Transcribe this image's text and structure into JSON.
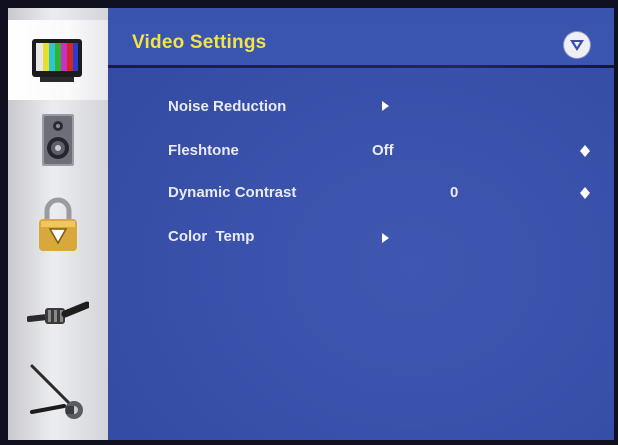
{
  "header": {
    "title": "Video Settings",
    "logo_icon": "vizio-v-logo-icon"
  },
  "sidebar": {
    "items": [
      {
        "icon": "tv-color-bars-icon",
        "active": true
      },
      {
        "icon": "speaker-icon",
        "active": false
      },
      {
        "icon": "padlock-icon",
        "active": false
      },
      {
        "icon": "cable-connector-icon",
        "active": false
      },
      {
        "icon": "wrench-tool-icon",
        "active": false
      }
    ]
  },
  "menu": [
    {
      "label": "Noise Reduction",
      "control": "submenu-arrow"
    },
    {
      "label": "Fleshtone",
      "value": "Off",
      "control": "up-down"
    },
    {
      "label": "Dynamic Contrast",
      "value": "0",
      "control": "up-down"
    },
    {
      "label": "Color  Temp",
      "control": "submenu-arrow"
    }
  ],
  "colors": {
    "title": "#f3e24a",
    "panel": "#3a52ab",
    "menu_text": "#e8eaf4",
    "sidebar": "#e2e3e8"
  }
}
